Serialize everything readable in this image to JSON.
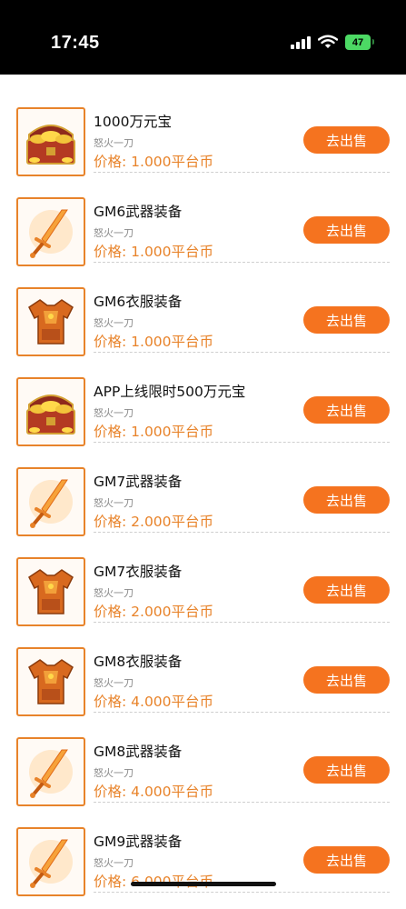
{
  "status_bar": {
    "time": "17:45",
    "battery": "47"
  },
  "colors": {
    "accent": "#f5731f",
    "price": "#e8832a"
  },
  "items": [
    {
      "title": "1000万元宝",
      "seller": "怒火一刀",
      "price": "价格: 1.000平台币",
      "action": "去出售",
      "icon": "treasure-chest-icon"
    },
    {
      "title": "GM6武器装备",
      "seller": "怒火一刀",
      "price": "价格: 1.000平台币",
      "action": "去出售",
      "icon": "sword-icon"
    },
    {
      "title": "GM6衣服装备",
      "seller": "怒火一刀",
      "price": "价格: 1.000平台币",
      "action": "去出售",
      "icon": "armor-icon"
    },
    {
      "title": "APP上线限时500万元宝",
      "seller": "怒火一刀",
      "price": "价格: 1.000平台币",
      "action": "去出售",
      "icon": "treasure-chest-icon"
    },
    {
      "title": "GM7武器装备",
      "seller": "怒火一刀",
      "price": "价格: 2.000平台币",
      "action": "去出售",
      "icon": "sword-icon"
    },
    {
      "title": "GM7衣服装备",
      "seller": "怒火一刀",
      "price": "价格: 2.000平台币",
      "action": "去出售",
      "icon": "armor-icon"
    },
    {
      "title": "GM8衣服装备",
      "seller": "怒火一刀",
      "price": "价格: 4.000平台币",
      "action": "去出售",
      "icon": "armor-icon"
    },
    {
      "title": "GM8武器装备",
      "seller": "怒火一刀",
      "price": "价格: 4.000平台币",
      "action": "去出售",
      "icon": "sword-icon"
    },
    {
      "title": "GM9武器装备",
      "seller": "怒火一刀",
      "price": "价格: 6.000平台币",
      "action": "去出售",
      "icon": "sword-icon"
    }
  ]
}
